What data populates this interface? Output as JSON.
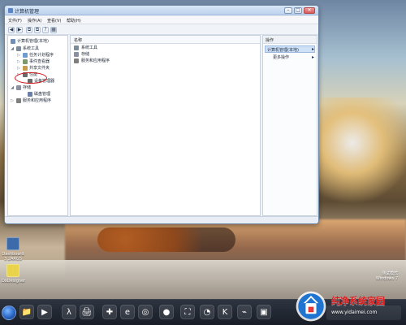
{
  "window": {
    "title": "计算机管理",
    "controls": {
      "minimize": "–",
      "maximize": "□",
      "close": "✕"
    }
  },
  "menubar": {
    "items": [
      "文件(F)",
      "操作(A)",
      "查看(V)",
      "帮助(H)"
    ]
  },
  "toolbar": {
    "buttons": [
      "◀",
      "▶",
      "⧉",
      "⧉",
      "?",
      "▦"
    ]
  },
  "left_pane": {
    "root_label": "计算机管理(本地)",
    "tree": [
      {
        "label": "系统工具",
        "expander": "◢"
      },
      {
        "label": "任务计划程序",
        "expander": "▷"
      },
      {
        "label": "事件查看器",
        "expander": "▷"
      },
      {
        "label": "共享文件夹",
        "expander": "▷"
      },
      {
        "label": "性能",
        "expander": "▷"
      },
      {
        "label": "设备管理器",
        "expander": ""
      },
      {
        "label": "存储",
        "expander": "◢"
      },
      {
        "label": "磁盘管理",
        "expander": ""
      },
      {
        "label": "服务和应用程序",
        "expander": "▷"
      }
    ]
  },
  "center_pane": {
    "column_header": "名称",
    "items": [
      "系统工具",
      "存储",
      "服务和应用程序"
    ]
  },
  "right_pane": {
    "header": "操作",
    "selected": "计算机管理(本地)",
    "more": "更多操作",
    "chevron": "▸"
  },
  "desktop_icons": [
    {
      "label": "Dashboard\n3.2ARGS"
    },
    {
      "label": "DxDesigner"
    }
  ],
  "taskbar": {
    "apps": [
      "📁",
      "▶",
      "λ",
      "🖨",
      "✚",
      "e",
      "◎",
      "●",
      "⛶",
      "◔",
      "K",
      "⌁",
      "▣"
    ]
  },
  "activation": {
    "line1": "测试模式",
    "line2": "Windows 7"
  },
  "watermark": {
    "title": "纯净系统家园",
    "url": "www.yidaimei.com"
  },
  "colors": {
    "accent": "#6c84a3",
    "selection": "#cfe1f7",
    "highlight_oval": "#d01818",
    "watermark_title": "#e11b1b"
  }
}
